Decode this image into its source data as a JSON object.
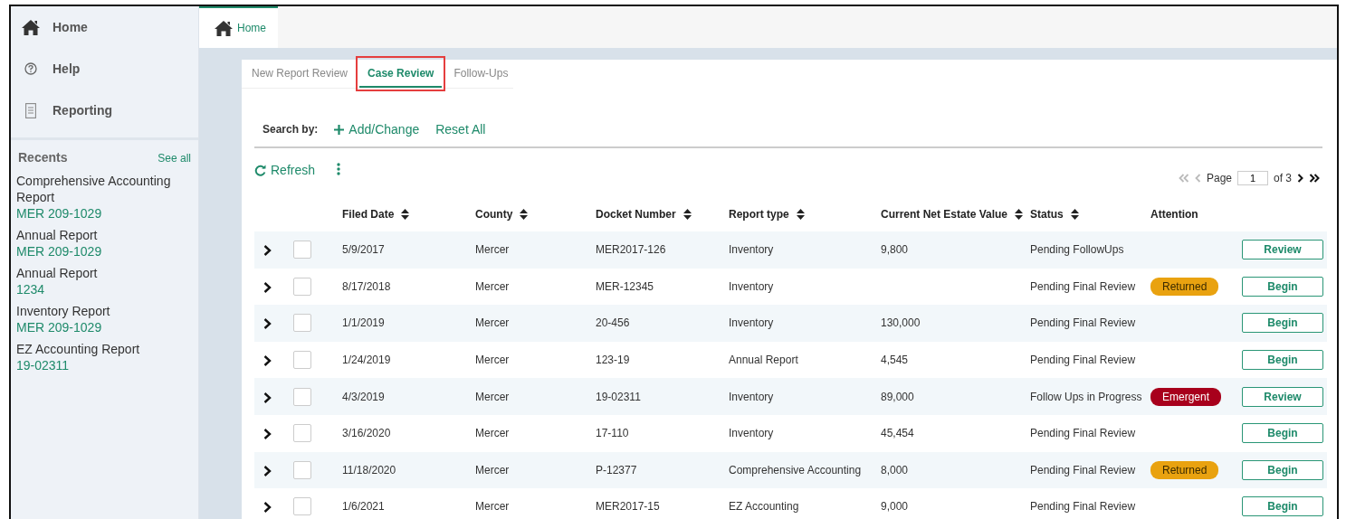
{
  "sidebar": {
    "nav": [
      {
        "label": "Home"
      },
      {
        "label": "Help"
      },
      {
        "label": "Reporting"
      }
    ],
    "recents": {
      "title": "Recents",
      "see_all": "See all",
      "items": [
        {
          "title": "Comprehensive Accounting Report",
          "code": "MER 209-1029"
        },
        {
          "title": "Annual Report",
          "code": "MER 209-1029"
        },
        {
          "title": "Annual Report",
          "code": "1234"
        },
        {
          "title": "Inventory Report",
          "code": "MER 209-1029"
        },
        {
          "title": "EZ Accounting Report",
          "code": "19-02311"
        }
      ]
    }
  },
  "top_tabs": [
    {
      "label": "Home",
      "selected": true
    }
  ],
  "tabs": [
    {
      "label": "New Report Review",
      "selected": false,
      "highlighted": false
    },
    {
      "label": "Case Review",
      "selected": true,
      "highlighted": true
    },
    {
      "label": "Follow-Ups",
      "selected": false,
      "highlighted": false
    }
  ],
  "search": {
    "label": "Search by:",
    "add": "Add/Change",
    "reset": "Reset All"
  },
  "toolbar": {
    "refresh": "Refresh"
  },
  "pager": {
    "label": "Page",
    "value": "1",
    "total": "of 3"
  },
  "table": {
    "columns": [
      {
        "label": "Filed Date",
        "sortable": true
      },
      {
        "label": "County",
        "sortable": true
      },
      {
        "label": "Docket Number",
        "sortable": true
      },
      {
        "label": "Report type",
        "sortable": true
      },
      {
        "label": "Current Net Estate Value",
        "sortable": true
      },
      {
        "label": "Status",
        "sortable": true
      },
      {
        "label": "Attention",
        "sortable": false
      }
    ],
    "rows": [
      {
        "expanded": false,
        "checked": false,
        "cells": [
          "5/9/2017",
          "Mercer",
          "MER2017-126",
          "Inventory",
          "9,800",
          "Pending FollowUps"
        ],
        "action": "Review"
      },
      {
        "expanded": false,
        "checked": false,
        "cells": [
          "8/17/2018",
          "Mercer",
          "MER-12345",
          "Inventory",
          "",
          "Pending Final Review"
        ],
        "attention": {
          "label": "Returned",
          "color": "#e9a210"
        },
        "action": "Begin"
      },
      {
        "expanded": false,
        "checked": false,
        "cells": [
          "1/1/2019",
          "Mercer",
          "20-456",
          "Inventory",
          "130,000",
          "Pending Final Review"
        ],
        "action": "Begin"
      },
      {
        "expanded": false,
        "checked": false,
        "cells": [
          "1/24/2019",
          "Mercer",
          "123-19",
          "Annual Report",
          "4,545",
          "Pending Final Review"
        ],
        "action": "Begin"
      },
      {
        "expanded": false,
        "checked": false,
        "cells": [
          "4/3/2019",
          "Mercer",
          "19-02311",
          "Inventory",
          "89,000",
          "Follow Ups in Progress"
        ],
        "attention": {
          "label": "Emergent",
          "color": "#a8001c"
        },
        "action": "Review"
      },
      {
        "expanded": false,
        "checked": false,
        "cells": [
          "3/16/2020",
          "Mercer",
          "17-110",
          "Inventory",
          "45,454",
          "Pending Final Review"
        ],
        "action": "Begin"
      },
      {
        "expanded": false,
        "checked": false,
        "cells": [
          "11/18/2020",
          "Mercer",
          "P-12377",
          "Comprehensive Accounting",
          "8,000",
          "Pending Final Review"
        ],
        "attention": {
          "label": "Returned",
          "color": "#e9a210"
        },
        "action": "Begin"
      },
      {
        "expanded": false,
        "checked": false,
        "cells": [
          "1/6/2021",
          "Mercer",
          "MER2017-15",
          "EZ Accounting",
          "9,000",
          "Pending Final Review"
        ],
        "action": "Begin"
      }
    ]
  }
}
